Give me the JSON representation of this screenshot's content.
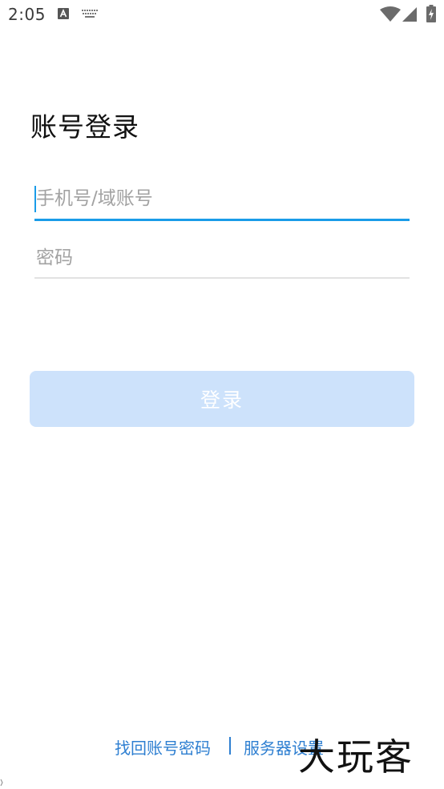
{
  "status_bar": {
    "time": "2:05",
    "icons": [
      "a-notification-icon",
      "keyboard-icon",
      "wifi-icon",
      "signal-icon",
      "battery-charging-icon"
    ]
  },
  "login": {
    "title": "账号登录",
    "phone_placeholder": "手机号/域账号",
    "phone_value": "",
    "password_placeholder": "密码",
    "password_value": "",
    "login_button": "登录"
  },
  "footer": {
    "recover_link": "找回账号密码",
    "server_link": "服务器设置"
  },
  "watermark": {
    "text": "大玩客"
  },
  "colors": {
    "accent": "#1a9ce8",
    "button_disabled": "#cde2fb",
    "link": "#2e7fd1",
    "placeholder": "#a2a2a2"
  }
}
